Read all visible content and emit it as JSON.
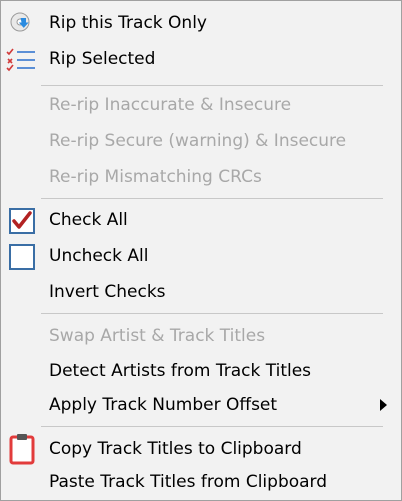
{
  "menu": {
    "rip_this": "Rip this Track Only",
    "rip_selected": "Rip Selected",
    "rerip_inaccurate": "Re-rip Inaccurate & Insecure",
    "rerip_secure": "Re-rip Secure (warning) & Insecure",
    "rerip_mismatch": "Re-rip Mismatching CRCs",
    "check_all": "Check All",
    "uncheck_all": "Uncheck All",
    "invert_checks": "Invert Checks",
    "swap_artist": "Swap Artist & Track Titles",
    "detect_artists": "Detect Artists from Track Titles",
    "apply_offset": "Apply Track Number Offset",
    "copy_titles": "Copy Track Titles to Clipboard",
    "paste_titles": "Paste Track Titles from Clipboard"
  },
  "icons": {
    "rip_this": "disc-rip-icon",
    "rip_selected": "checklist-icon",
    "check_all": "checkbox-checked-icon",
    "uncheck_all": "checkbox-empty-icon",
    "copy_titles": "clipboard-icon",
    "apply_offset": "submenu-arrow-icon"
  },
  "colors": {
    "menu_background": "#f2f2f2",
    "disabled_text": "#a8a8a8",
    "check_red": "#b22222",
    "checkbox_border": "#3a6ea5",
    "clipboard_red": "#e23b3b"
  }
}
